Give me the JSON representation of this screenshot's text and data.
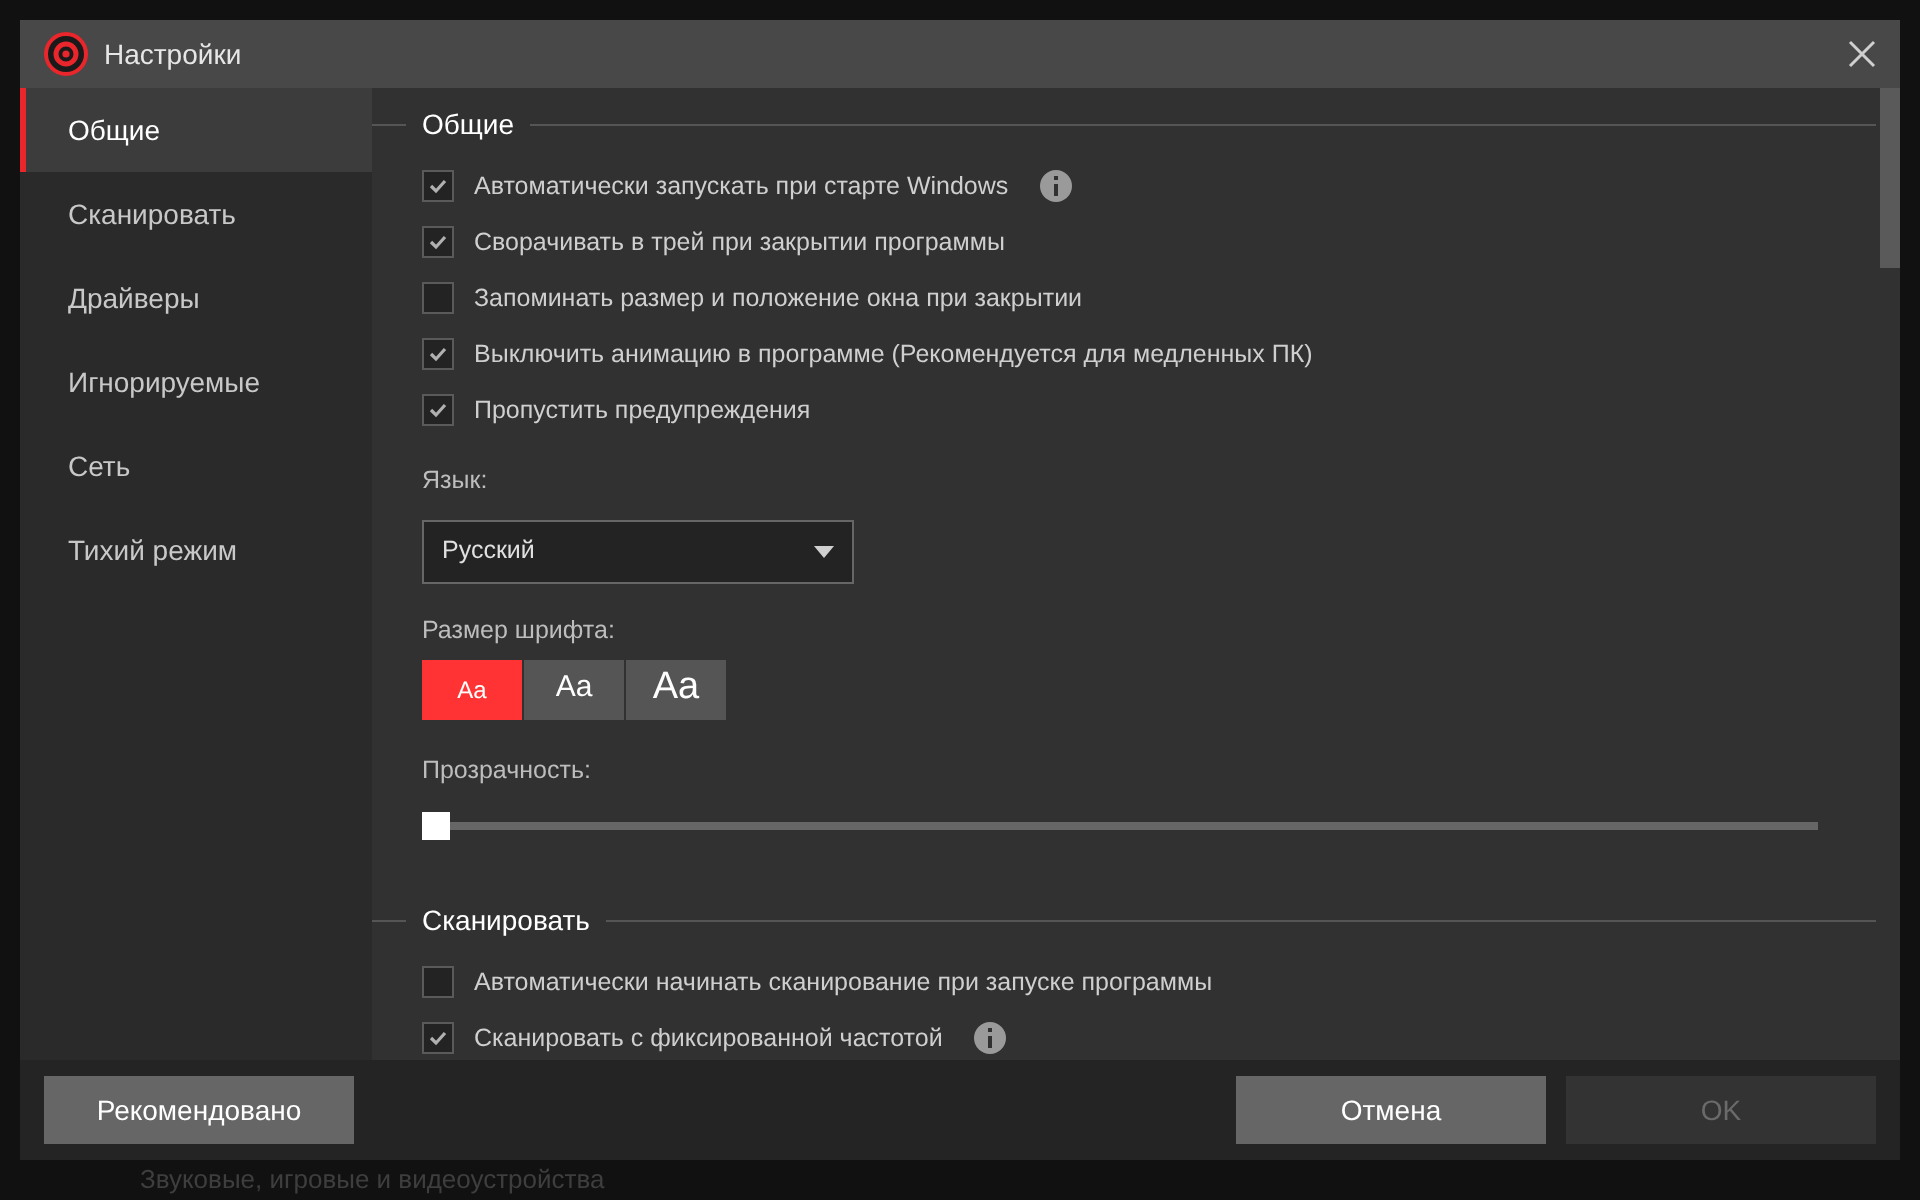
{
  "window": {
    "title": "Настройки"
  },
  "background": {
    "footer_text": "Звуковые, игровые и видеоустройства"
  },
  "sidebar": {
    "items": [
      {
        "label": "Общие",
        "selected": true
      },
      {
        "label": "Сканировать",
        "selected": false
      },
      {
        "label": "Драйверы",
        "selected": false
      },
      {
        "label": "Игнорируемые",
        "selected": false
      },
      {
        "label": "Сеть",
        "selected": false
      },
      {
        "label": "Тихий режим",
        "selected": false
      }
    ]
  },
  "sections": [
    {
      "title": "Общие",
      "options": [
        {
          "label": "Автоматически запускать при старте Windows",
          "checked": true,
          "info": true
        },
        {
          "label": "Сворачивать в трей при закрытии программы",
          "checked": true,
          "info": false
        },
        {
          "label": "Запоминать размер и положение окна при закрытии",
          "checked": false,
          "info": false
        },
        {
          "label": "Выключить анимацию в программе (Рекомендуется для медленных ПК)",
          "checked": true,
          "info": false
        },
        {
          "label": "Пропустить предупреждения",
          "checked": true,
          "info": false
        }
      ],
      "language": {
        "label": "Язык:",
        "value": "Русский"
      },
      "font_size": {
        "label": "Размер шрифта:",
        "options": [
          {
            "label": "Aa",
            "selected": true
          },
          {
            "label": "Aa",
            "selected": false
          },
          {
            "label": "Aa",
            "selected": false
          }
        ]
      },
      "transparency": {
        "label": "Прозрачность:",
        "level": 0
      }
    },
    {
      "title": "Сканировать",
      "options": [
        {
          "label": "Автоматически начинать сканирование при запуске программы",
          "checked": false,
          "info": false
        },
        {
          "label": "Сканировать с фиксированной частотой",
          "checked": true,
          "info": true
        }
      ]
    }
  ],
  "buttons": [
    {
      "label": "Рекомендовано",
      "disabled": false
    },
    {
      "label": "Отмена",
      "disabled": false
    },
    {
      "label": "OK",
      "disabled": true
    }
  ]
}
